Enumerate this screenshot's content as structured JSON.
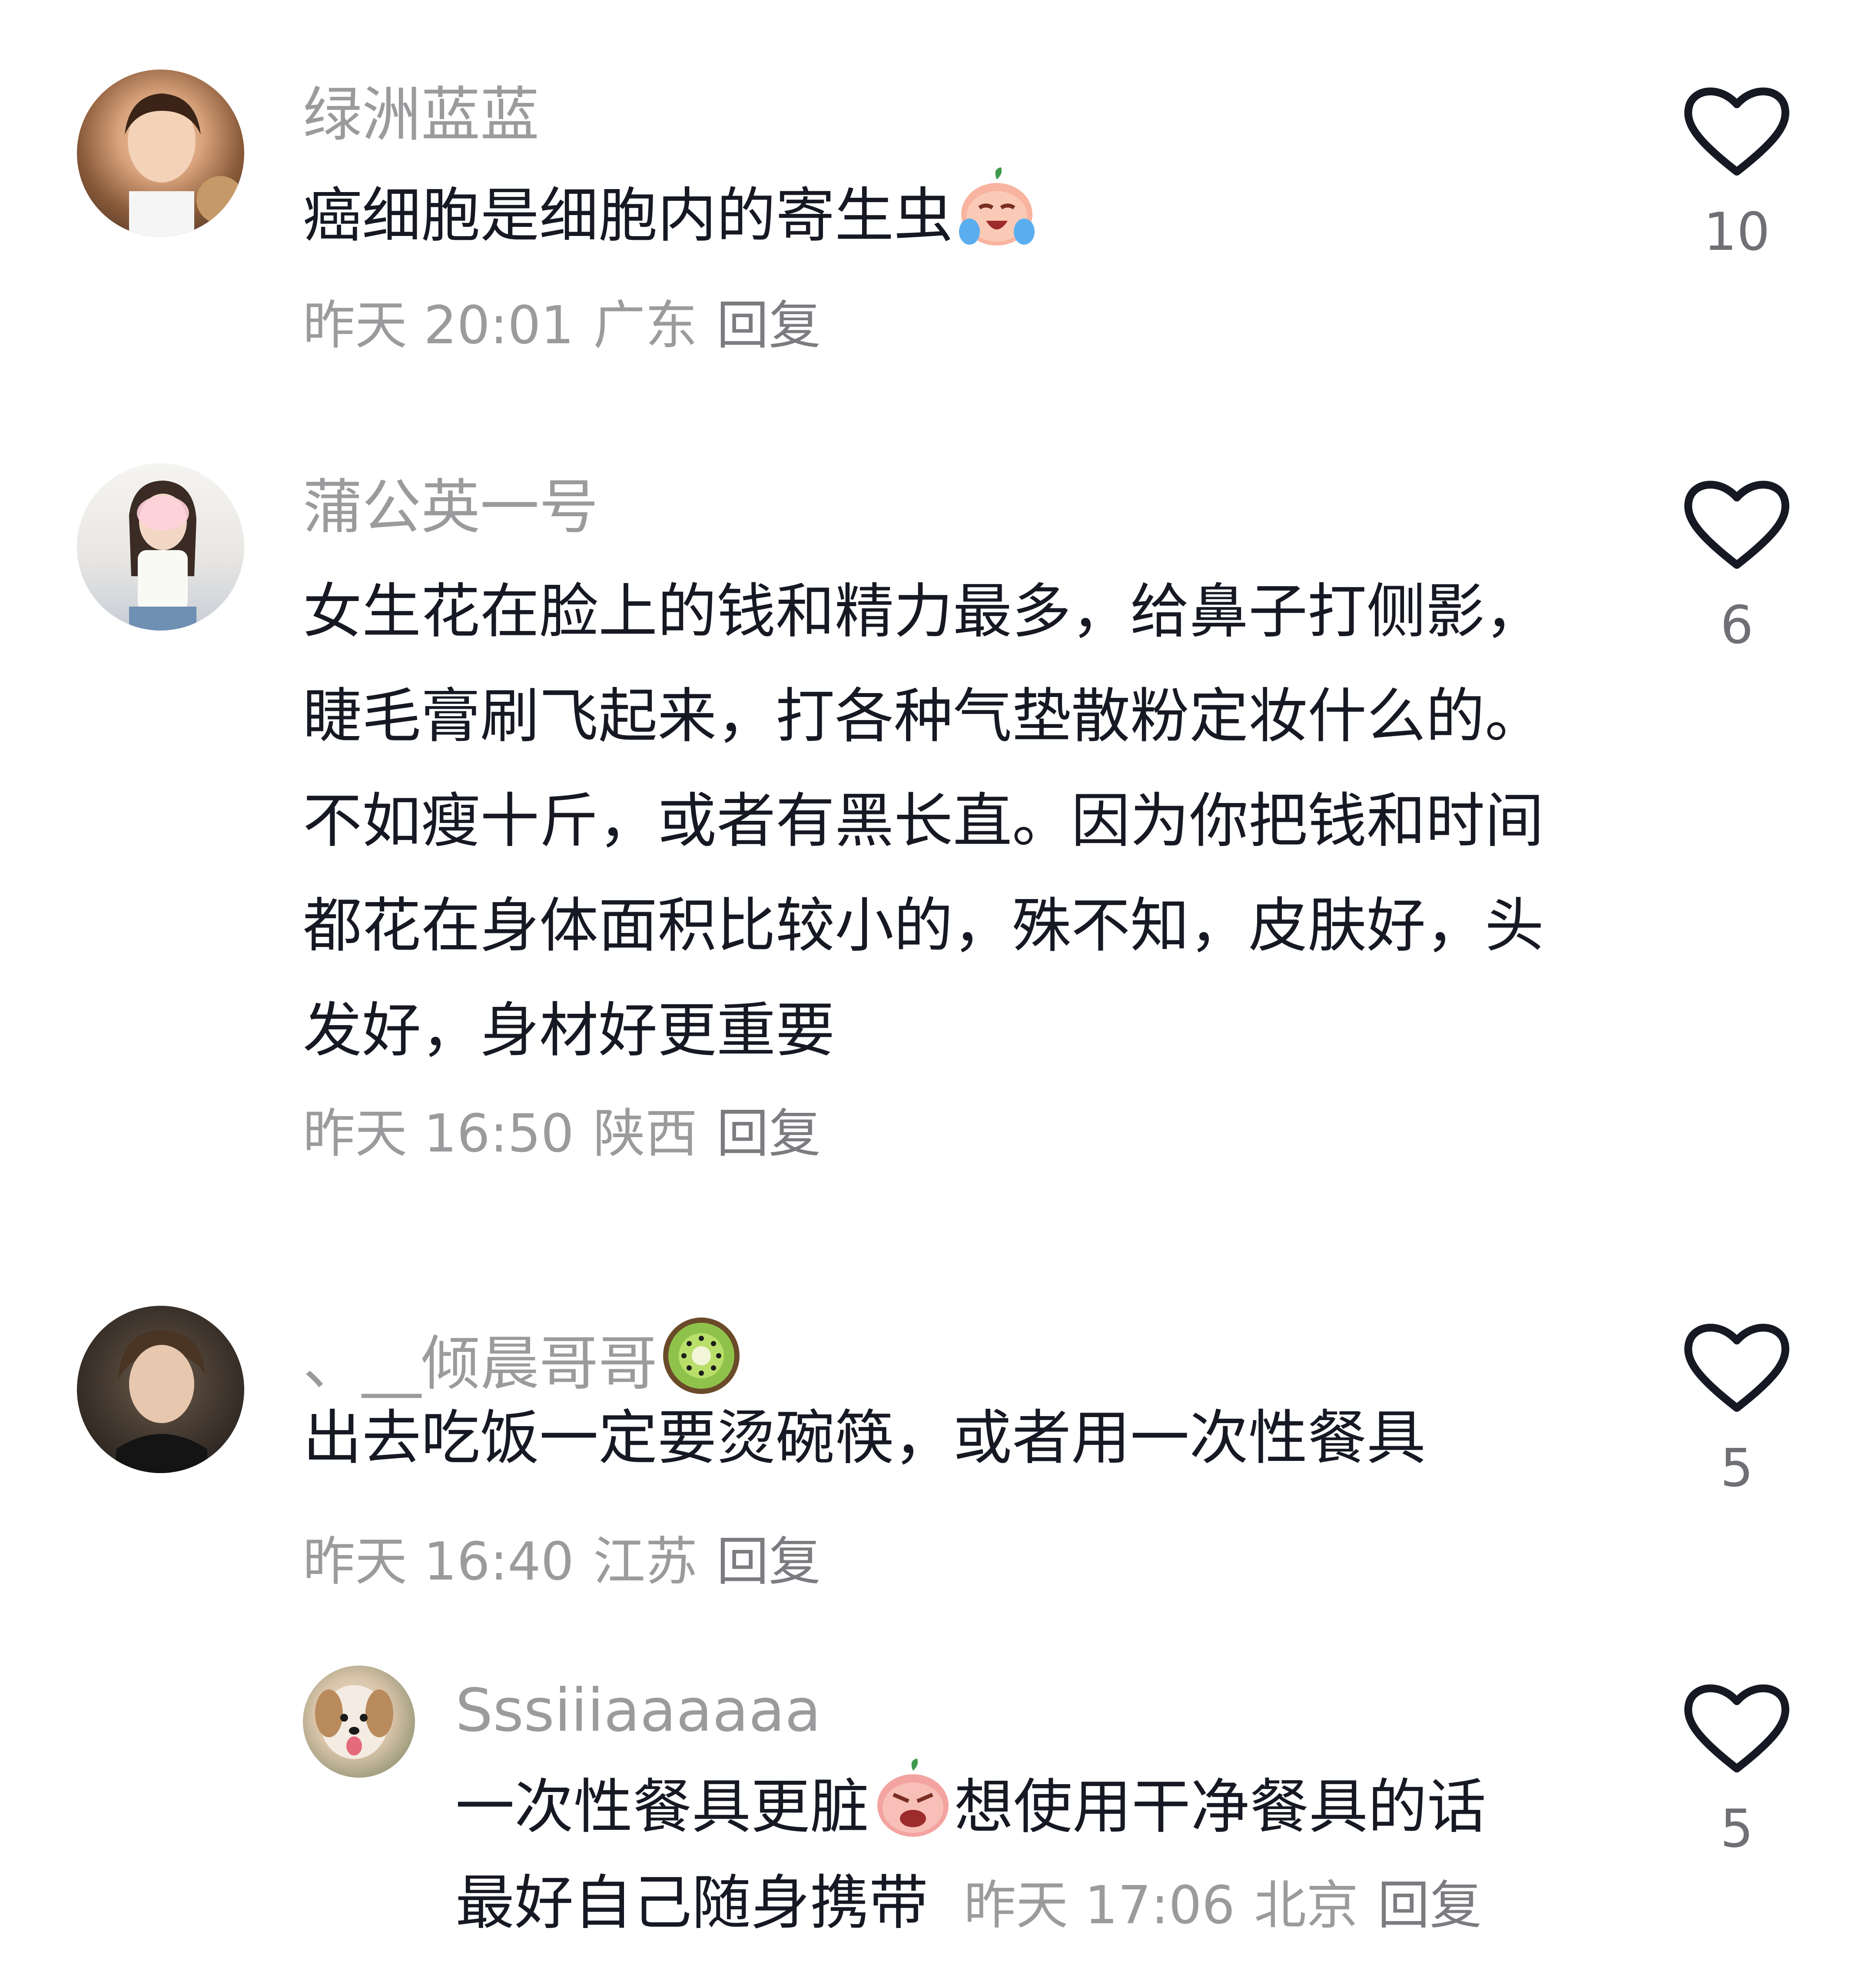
{
  "comments": [
    {
      "username": "绿洲蓝蓝",
      "text": "癌细胞是细胞内的寄生虫",
      "date": "昨天 20:01",
      "location": "广东",
      "reply_label": "回复",
      "likes": "10",
      "avatar_icon": "avatar-girl-photo",
      "emoji_icon": "crying-peach-emoji"
    },
    {
      "username": "蒲公英一号",
      "text": "女生花在脸上的钱和精力最多，给鼻子打侧影，睫毛膏刷飞起来，打各种气垫散粉定妆什么的。不如瘦十斤，或者有黑长直。因为你把钱和时间都花在身体面积比较小的，殊不知，皮肤好，头发好，身材好更重要",
      "date": "昨天 16:50",
      "location": "陕西",
      "reply_label": "回复",
      "likes": "6",
      "avatar_icon": "avatar-selfie-photo"
    },
    {
      "username": "、__倾晨哥哥",
      "text": "出去吃饭一定要烫碗筷，或者用一次性餐具",
      "date": "昨天 16:40",
      "location": "江苏",
      "reply_label": "回复",
      "likes": "5",
      "avatar_icon": "avatar-man-photo",
      "emoji_icon": "kiwi-emoji"
    }
  ],
  "reply": {
    "username": "Sssiiiaaaaaa",
    "text_part1": "一次性餐具更脏",
    "text_part2": "想使用干净餐具的话",
    "text_line2": "最好自己随身携带",
    "date": "昨天 17:06",
    "location": "北京",
    "reply_label": "回复",
    "likes": "5",
    "avatar_icon": "avatar-dog-photo",
    "emoji_icon": "angry-peach-emoji"
  },
  "colors": {
    "username": "#9b9b9e",
    "text": "#161823",
    "meta": "#9b9b9e",
    "like_icon": "#161823"
  }
}
